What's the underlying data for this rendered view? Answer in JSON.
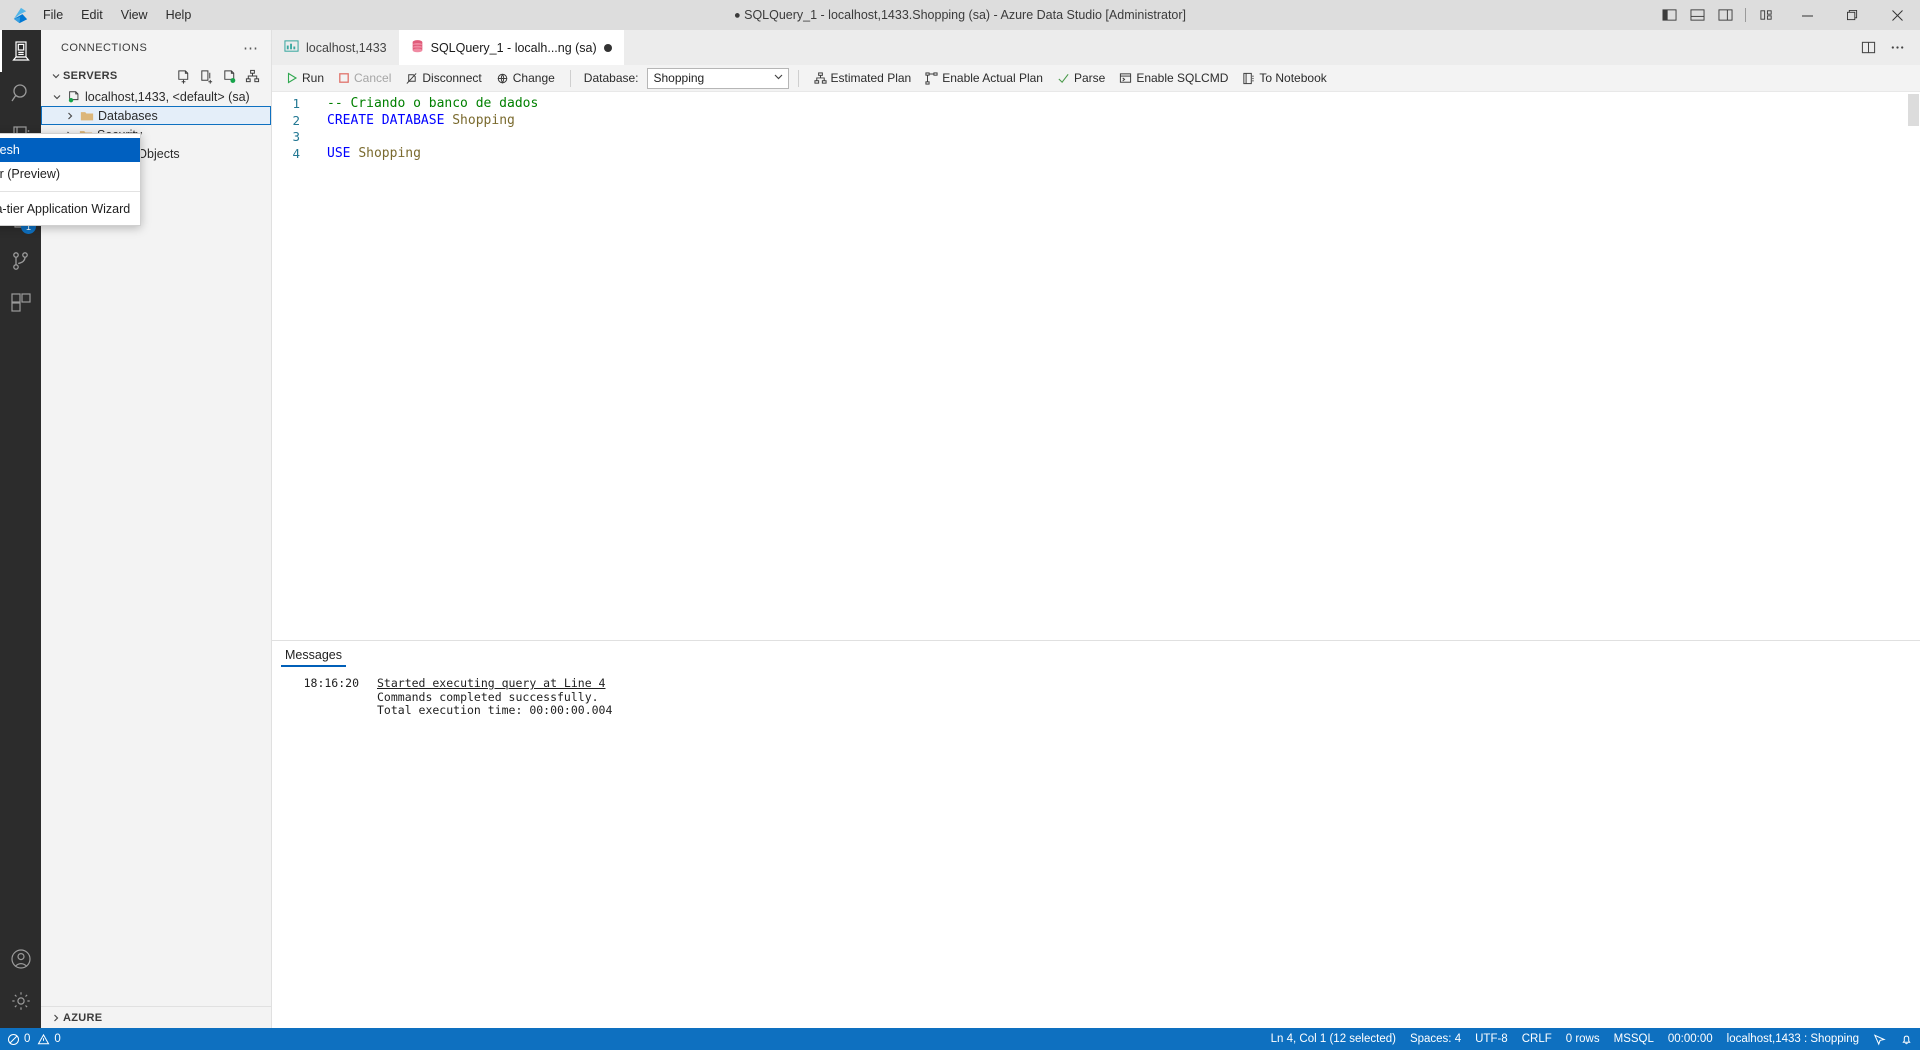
{
  "titlebar": {
    "app_icon": "azure-data-studio-logo",
    "menus": [
      "File",
      "Edit",
      "View",
      "Help"
    ],
    "title": "SQLQuery_1 - localhost,1433.Shopping (sa) - Azure Data Studio [Administrator]",
    "dirty_marker": "●",
    "layout_buttons": [
      {
        "name": "toggle-primary-sidebar-icon",
        "tooltip": "Toggle Primary Side Bar"
      },
      {
        "name": "toggle-panel-icon",
        "tooltip": "Toggle Panel"
      },
      {
        "name": "toggle-secondary-sidebar-icon",
        "tooltip": "Toggle Secondary Side Bar"
      },
      {
        "name": "customize-layout-icon",
        "tooltip": "Customize Layout"
      }
    ],
    "window_buttons": [
      {
        "name": "minimize-button",
        "glyph": "─"
      },
      {
        "name": "maximize-button",
        "glyph": "❐"
      },
      {
        "name": "close-button",
        "glyph": "✕"
      }
    ]
  },
  "activitybar": {
    "items": [
      {
        "name": "servers",
        "icon": "servers-icon",
        "active": true,
        "badge": null
      },
      {
        "name": "search",
        "icon": "search-icon",
        "active": false,
        "badge": null
      },
      {
        "name": "notebooks",
        "icon": "notebook-icon",
        "active": false,
        "badge": null
      },
      {
        "name": "dashboards",
        "icon": "dashboard-icon",
        "active": false,
        "badge": null
      },
      {
        "name": "source-control",
        "icon": "source-control-icon",
        "active": false,
        "badge": "1"
      },
      {
        "name": "branches",
        "icon": "git-branch-icon",
        "active": false,
        "badge": null
      },
      {
        "name": "extensions",
        "icon": "extensions-icon",
        "active": false,
        "badge": null
      }
    ],
    "bottom_items": [
      {
        "name": "accounts",
        "icon": "account-icon"
      },
      {
        "name": "manage",
        "icon": "gear-icon"
      }
    ]
  },
  "sidebar": {
    "title": "CONNECTIONS",
    "more_actions": "⋯",
    "section": {
      "label": "SERVERS",
      "expanded": true,
      "actions": [
        {
          "name": "new-connection-icon"
        },
        {
          "name": "new-connection-group-icon"
        },
        {
          "name": "new-server-icon"
        },
        {
          "name": "server-groups-icon"
        }
      ]
    },
    "tree": [
      {
        "label": "localhost,1433, <default> (sa)",
        "icon": "server-icon",
        "level": 0,
        "expanded": true,
        "selected": false
      },
      {
        "label": "Databases",
        "icon": "folder-icon",
        "level": 1,
        "expanded": false,
        "selected": true
      },
      {
        "label": "Security",
        "icon": "folder-icon",
        "level": 1,
        "expanded": false,
        "selected": false
      },
      {
        "label": "Server Objects",
        "icon": "folder-icon",
        "level": 1,
        "expanded": false,
        "selected": false
      }
    ],
    "azure_section": {
      "label": "AZURE",
      "expanded": false
    }
  },
  "context_menu": {
    "items": [
      {
        "label": "Refresh",
        "highlighted": true,
        "separator_after": false
      },
      {
        "label": "Filter (Preview)",
        "highlighted": false,
        "separator_after": true
      },
      {
        "label": "Data-tier Application Wizard",
        "highlighted": false,
        "separator_after": false
      }
    ]
  },
  "tabs": [
    {
      "label": "localhost,1433",
      "icon": "dashboard-tab-icon",
      "active": false,
      "dirty": false
    },
    {
      "label": "SQLQuery_1 - localh...ng (sa)",
      "icon": "sql-file-icon",
      "active": true,
      "dirty": true
    }
  ],
  "tab_actions": [
    {
      "name": "split-editor-icon"
    },
    {
      "name": "editor-more-actions-icon"
    }
  ],
  "query_toolbar": {
    "run_label": "Run",
    "cancel_label": "Cancel",
    "disconnect_label": "Disconnect",
    "change_label": "Change",
    "database_label": "Database:",
    "database_value": "Shopping",
    "estimated_plan_label": "Estimated Plan",
    "enable_actual_plan_label": "Enable Actual Plan",
    "parse_label": "Parse",
    "enable_sqlcmd_label": "Enable SQLCMD",
    "to_notebook_label": "To Notebook"
  },
  "editor": {
    "lines": [
      {
        "number": "1",
        "tokens": [
          {
            "text": "-- Criando o banco de dados",
            "type": "comment"
          }
        ]
      },
      {
        "number": "2",
        "tokens": [
          {
            "text": "CREATE DATABASE ",
            "type": "keyword"
          },
          {
            "text": "Shopping",
            "type": "identifier"
          }
        ]
      },
      {
        "number": "3",
        "tokens": [
          {
            "text": "",
            "type": "plain"
          }
        ]
      },
      {
        "number": "4",
        "tokens": [
          {
            "text": "USE ",
            "type": "keyword"
          },
          {
            "text": "Shopping",
            "type": "identifier"
          }
        ]
      }
    ]
  },
  "results": {
    "tabs": [
      {
        "label": "Messages",
        "active": true
      }
    ],
    "messages": [
      {
        "time": "18:16:20",
        "text": "Started executing query at Line 4",
        "link": true
      },
      {
        "time": "",
        "text": "Commands completed successfully.",
        "link": false
      },
      {
        "time": "",
        "text": "Total execution time: 00:00:00.004",
        "link": false
      }
    ]
  },
  "statusbar": {
    "errors": "0",
    "warnings": "0",
    "cursor_position": "Ln 4, Col 1 (12 selected)",
    "indentation": "Spaces: 4",
    "encoding": "UTF-8",
    "eol": "CRLF",
    "row_count": "0 rows",
    "language": "MSSQL",
    "execution_time": "00:00:00",
    "connection": "localhost,1433 : Shopping",
    "feedback_icon": "feedback-icon",
    "bell_icon": "bell-icon"
  },
  "colors": {
    "accent": "#0e70c0",
    "menu_highlight": "#0060c0",
    "titlebar_bg": "#dddddd",
    "activitybar_bg": "#2c2c2c",
    "sidebar_bg": "#f3f3f3",
    "comment_green": "#008000",
    "keyword_blue": "#0000ff",
    "identifier": "#7a6a2e",
    "badge_blue": "#0e70c0"
  }
}
